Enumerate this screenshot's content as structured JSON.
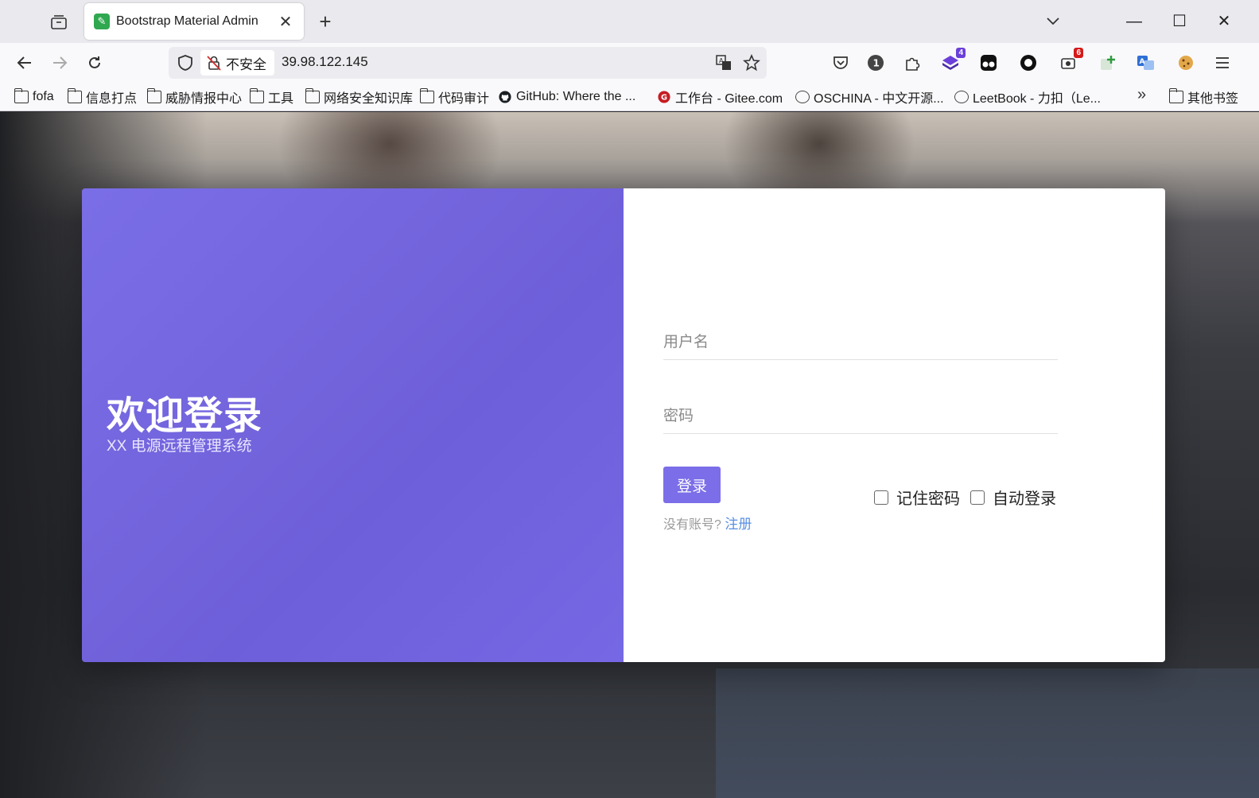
{
  "browser": {
    "tab_title": "Bootstrap Material Admin",
    "tab_close": "✕",
    "new_tab": "+",
    "url": "39.98.122.145",
    "insecure_label": "不安全",
    "controls": {
      "minimize": "—",
      "maximize": "☐",
      "close": "✕",
      "tab_list": "⌄"
    },
    "extension_badges": {
      "ext_puzzle_purple": "4",
      "ext_red": "6",
      "password_manager": "1"
    },
    "bookmarks": [
      {
        "label": "fofa",
        "icon": "folder-icon"
      },
      {
        "label": "信息打点",
        "icon": "folder-icon"
      },
      {
        "label": "威胁情报中心",
        "icon": "folder-icon"
      },
      {
        "label": "工具",
        "icon": "folder-icon"
      },
      {
        "label": "网络安全知识库",
        "icon": "folder-icon"
      },
      {
        "label": "代码审计",
        "icon": "folder-icon"
      },
      {
        "label": "GitHub: Where the ...",
        "icon": "github-icon"
      },
      {
        "label": "工作台 - Gitee.com",
        "icon": "gitee-icon"
      },
      {
        "label": "OSCHINA - 中文开源...",
        "icon": "globe-icon"
      },
      {
        "label": "LeetBook - 力扣（Le...",
        "icon": "globe-icon"
      },
      {
        "label": "其他书签",
        "icon": "folder-icon"
      }
    ]
  },
  "login": {
    "welcome_title": "欢迎登录",
    "subtitle": "XX 电源远程管理系统",
    "username_placeholder": "用户名",
    "password_placeholder": "密码",
    "login_button": "登录",
    "remember_password": "记住密码",
    "auto_login": "自动登录",
    "no_account_text": "没有账号?",
    "register_link": "注册"
  },
  "colors": {
    "accent": "#7b6ee8",
    "left_panel": "#7263db",
    "link": "#5a8fe0"
  }
}
